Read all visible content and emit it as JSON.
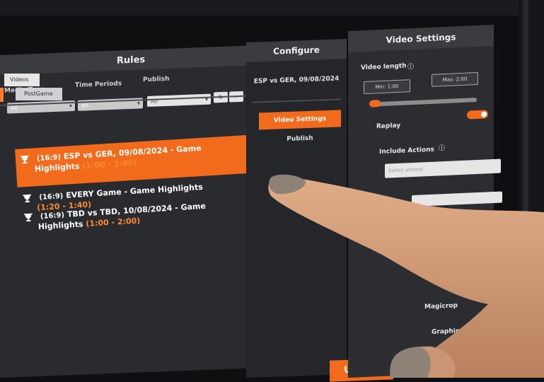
{
  "rules": {
    "title": "Rules",
    "filters": {
      "media_type_label": "Media Type",
      "media_type_value": "All",
      "time_periods_label": "Time Periods",
      "time_periods_value": "All",
      "publish_label": "Publish",
      "publish_value": "All"
    },
    "tags": [
      "Videos",
      "PostGame"
    ],
    "items": [
      {
        "ratio": "(16:9)",
        "title": "ESP vs GER, 09/08/2024 - Game Highlights",
        "range": "(1:00 - 2:00)",
        "count": "1"
      },
      {
        "ratio": "(16:9)",
        "title": "EVERY Game - Game Highlights",
        "range": "(1:20 - 1:40)",
        "count": "1"
      },
      {
        "ratio": "(16:9)",
        "title": "TBD vs TBD, 10/08/2024 - Game Highlights",
        "range": "(1:00 - 2:00)",
        "count": "1"
      }
    ]
  },
  "configure": {
    "title": "Configure",
    "selected_item": "ESP vs GER, 09/08/2024",
    "menu": [
      "Video Settings",
      "Publish"
    ],
    "update_label": "Update"
  },
  "video_settings": {
    "title": "Video Settings",
    "video_length_label": "Video length",
    "min_value": "Min: 1:00",
    "max_value": "Max: 2:00",
    "replay_label": "Replay",
    "include_actions_label": "Include Actions",
    "include_actions_placeholder": "Select actions",
    "magicrop_label": "Magicrop",
    "graphics_label": "Graphics"
  },
  "colors": {
    "accent": "#f26a1b",
    "panel": "#2a2b2e",
    "header": "#3a3c40"
  }
}
